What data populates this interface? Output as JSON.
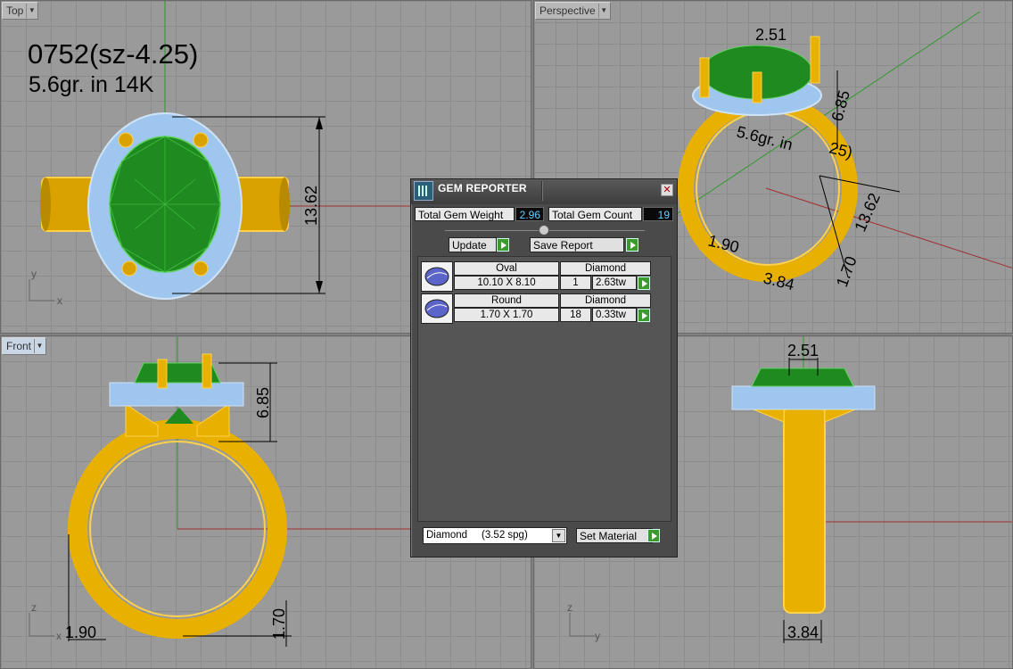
{
  "viewports": {
    "top": {
      "label": "Top",
      "axes": {
        "y": "y",
        "x": "x"
      }
    },
    "perspective": {
      "label": "Perspective"
    },
    "front": {
      "label": "Front",
      "axes": {
        "z": "z",
        "x": "x"
      }
    },
    "right": {
      "axes": {
        "z": "z",
        "y": "y"
      }
    }
  },
  "annotation": {
    "title": "0752(sz-4.25)",
    "subtitle": "5.6gr.  in 14K"
  },
  "dimensions": {
    "top_height": "13.62",
    "persp_top": "2.51",
    "persp_height": "6.85",
    "persp_length": "13.62",
    "persp_width": "1.90",
    "persp_small": "1.70",
    "persp_small2": "3.84",
    "persp_text": "5.6gr.  in",
    "persp_text2": "25)",
    "front_height": "6.85",
    "front_shank": "1.90",
    "front_bottom": "1.70",
    "right_top": "2.51",
    "right_bottom": "3.84"
  },
  "gem_reporter": {
    "title": "GEM REPORTER",
    "close": "✕",
    "total_weight_label": "Total Gem Weight",
    "total_weight_value": "2.96",
    "total_count_label": "Total Gem Count",
    "total_count_value": "19",
    "update_label": "Update",
    "save_report_label": "Save Report",
    "gems": [
      {
        "shape": "Oval",
        "material": "Diamond",
        "size": "10.10 X 8.10",
        "count": "1",
        "weight": "2.63tw"
      },
      {
        "shape": "Round",
        "material": "Diamond",
        "size": "1.70 X 1.70",
        "count": "18",
        "weight": "0.33tw"
      }
    ],
    "material_select": "Diamond     (3.52 spg)",
    "set_material_label": "Set Material"
  },
  "colors": {
    "gold": "#e8b000",
    "gem_green": "#1f8a1f",
    "accent_diamond": "#9ec6ee"
  }
}
